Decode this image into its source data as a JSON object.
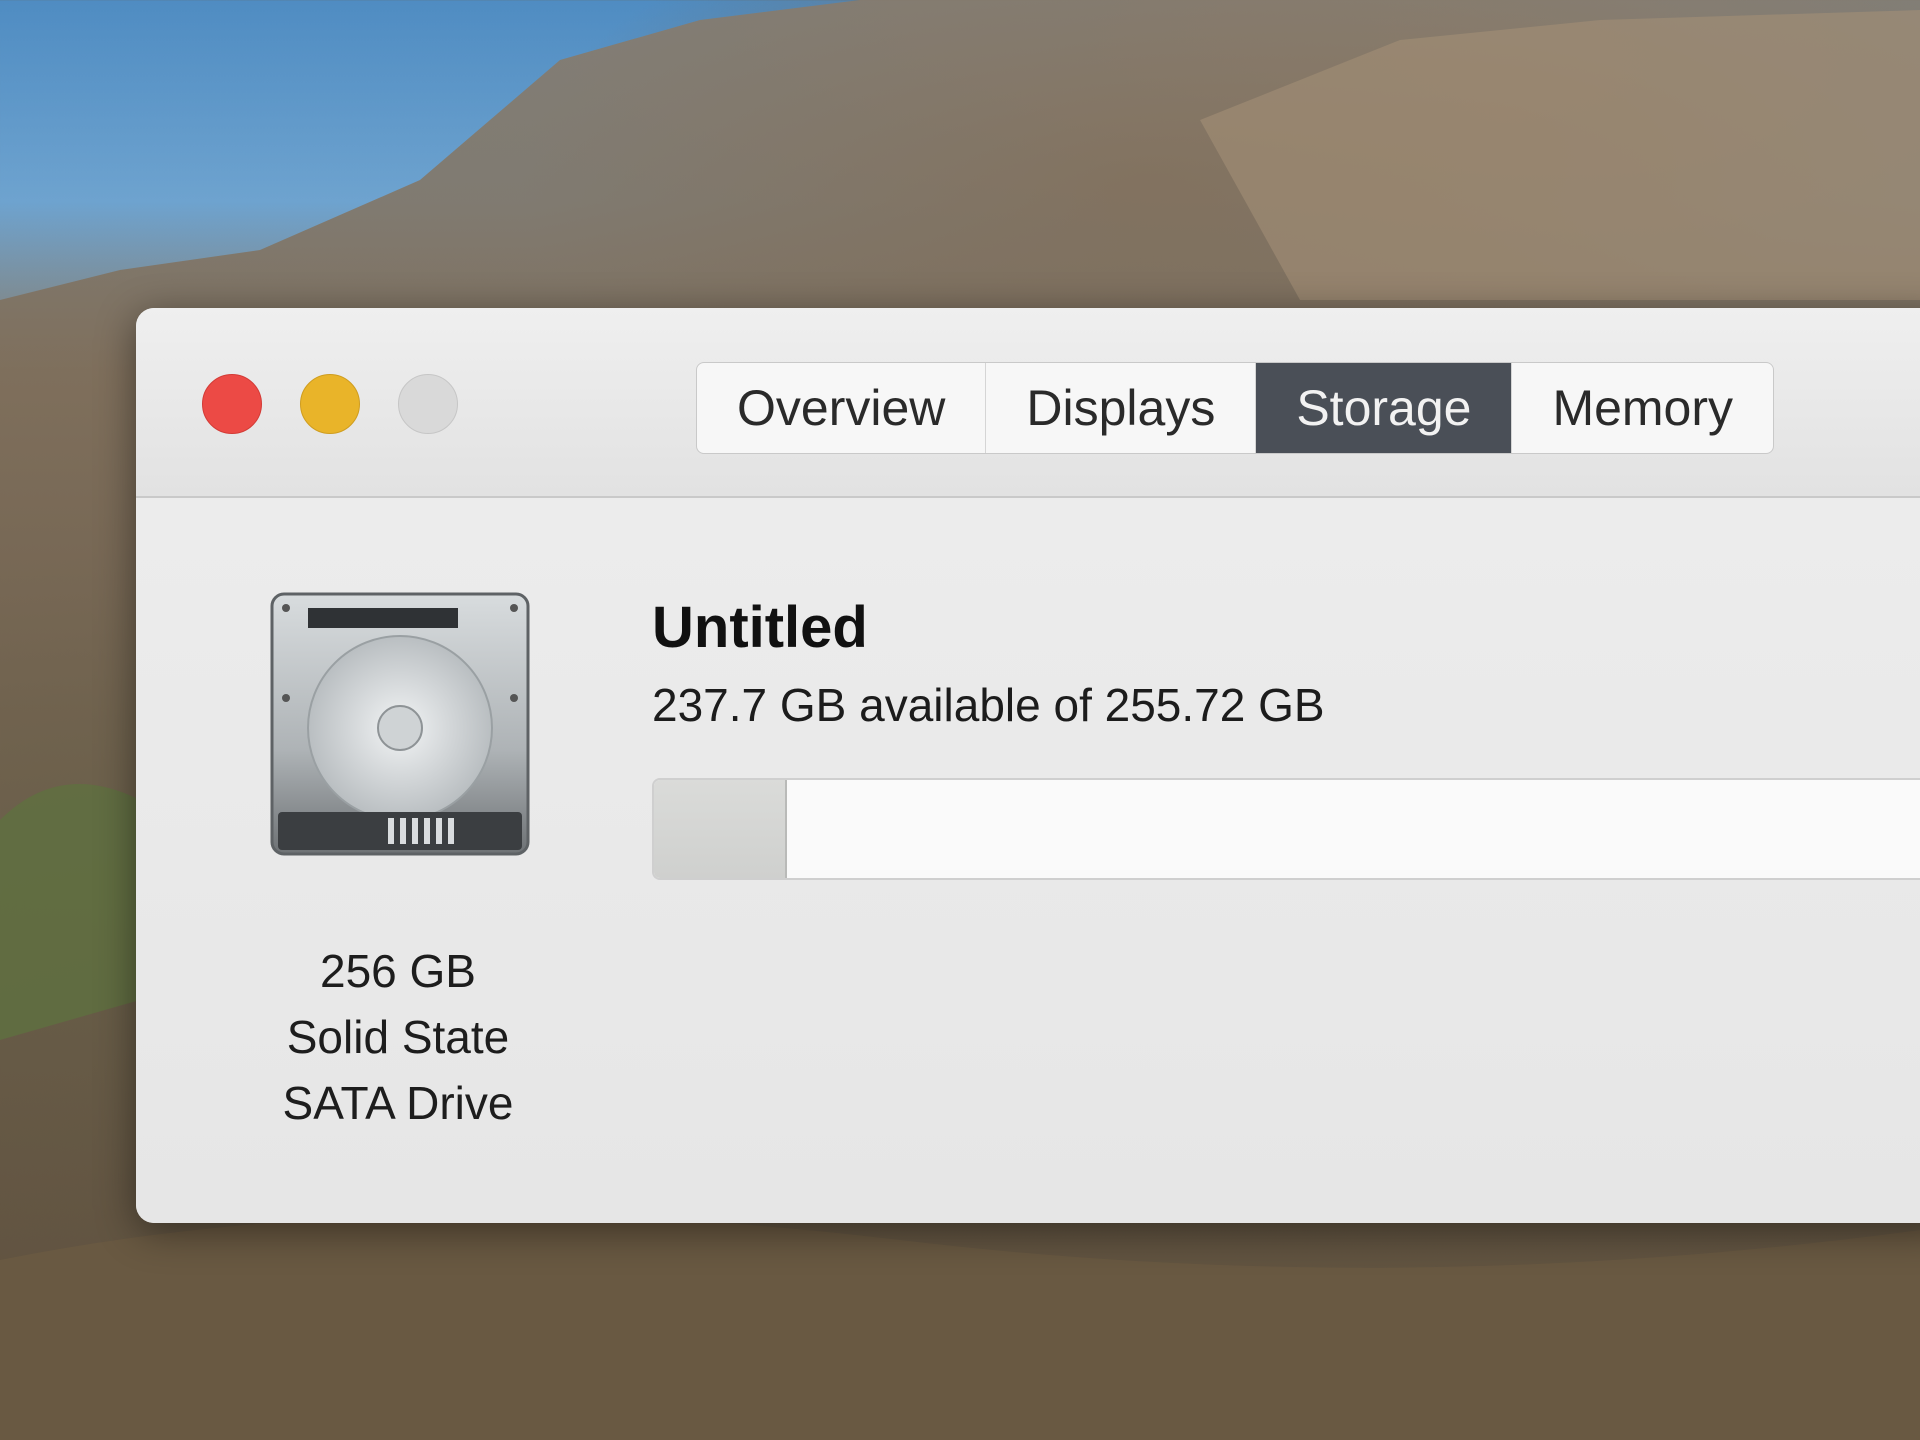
{
  "window": {
    "traffic_lights": [
      {
        "name": "close",
        "color": "#ec4a45"
      },
      {
        "name": "minimize",
        "color": "#e9b429"
      },
      {
        "name": "zoom",
        "color": "#d9d9d9"
      }
    ],
    "tabs": [
      {
        "label": "Overview",
        "active": false
      },
      {
        "label": "Displays",
        "active": false
      },
      {
        "label": "Storage",
        "active": true
      },
      {
        "label": "Memory",
        "active": false
      }
    ]
  },
  "storage": {
    "disk_icon": "hard-drive-icon",
    "disk_caption": [
      "256 GB",
      "Solid State",
      "SATA Drive"
    ],
    "volume_name": "Untitled",
    "capacity_text": "237.7 GB available of 255.72 GB",
    "used_gb": 18.02,
    "total_gb": 255.72,
    "used_fraction": 0.0705
  },
  "colors": {
    "active_tab": "#4a4f57",
    "used_segment": "#d3d4d2",
    "bar_background": "#fafafa"
  }
}
